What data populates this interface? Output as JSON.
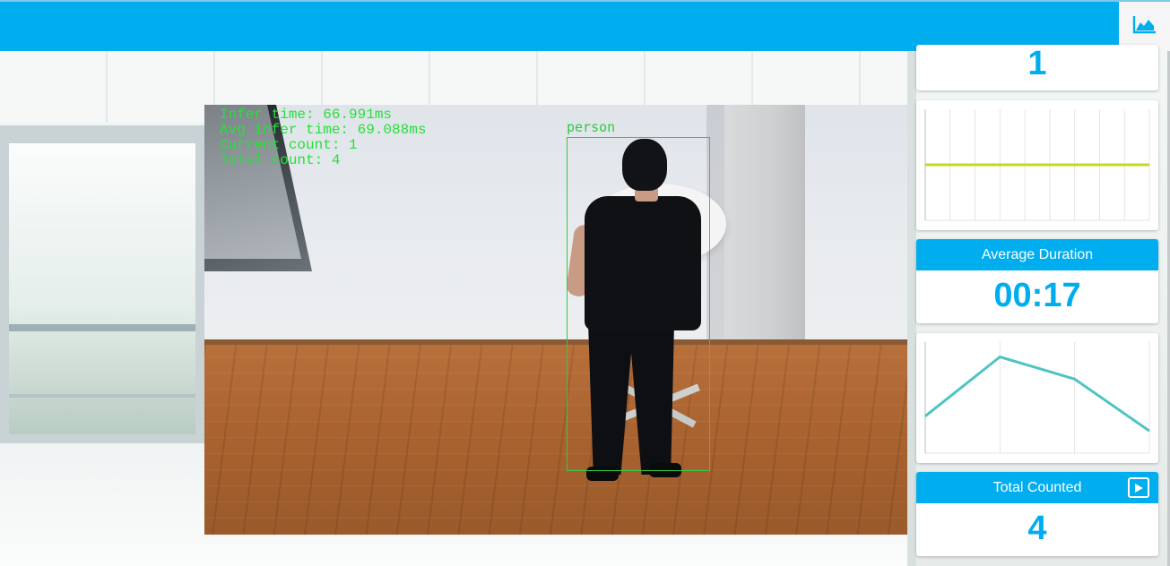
{
  "toolbar": {
    "stats_icon": "area-chart-icon"
  },
  "video": {
    "overlay_lines": [
      "Infer time: 66.991ms",
      "Avg infer time: 69.088ms",
      "Current count: 1",
      "Total count: 4"
    ],
    "detection_label": "person"
  },
  "panel": {
    "current_count": {
      "value": "1"
    },
    "average_duration": {
      "title": "Average Duration",
      "value": "00:17"
    },
    "total_counted": {
      "title": "Total Counted",
      "value": "4",
      "icon": "play-icon"
    }
  },
  "chart_data": [
    {
      "type": "line",
      "title": "",
      "x": [
        0,
        1,
        2,
        3,
        4,
        5,
        6,
        7,
        8,
        9
      ],
      "series": [
        {
          "values": [
            1,
            1,
            1,
            1,
            1,
            1,
            1,
            1,
            1,
            1
          ]
        }
      ],
      "ylim": [
        0,
        2
      ],
      "grid": true,
      "color": "#c5d81f"
    },
    {
      "type": "line",
      "title": "",
      "x": [
        0,
        1,
        2,
        3
      ],
      "series": [
        {
          "values": [
            10,
            26,
            20,
            6
          ]
        }
      ],
      "ylim": [
        0,
        30
      ],
      "grid": true,
      "color": "#4dc4c3"
    }
  ],
  "colors": {
    "accent": "#00aeef",
    "detection": "#2ecc40"
  }
}
